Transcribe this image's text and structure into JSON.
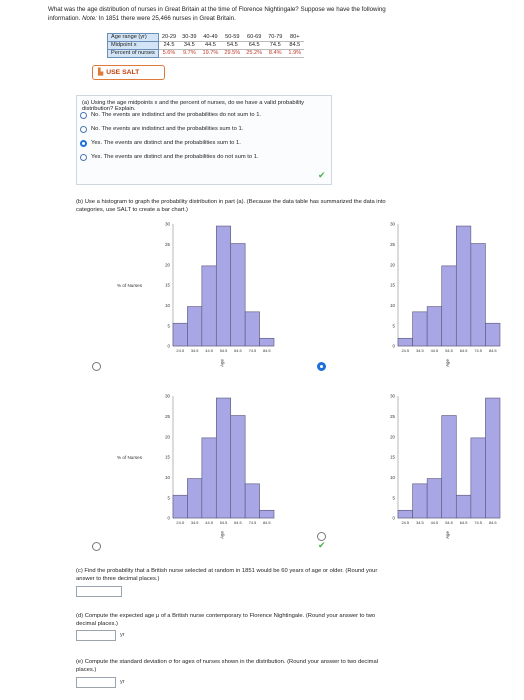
{
  "intro": {
    "line1": "What was the age distribution of nurses in Great Britain at the time of Florence Nightingale? Suppose we have the following",
    "line2_a": "information.",
    "line2_note": "Note:",
    "line2_b": "In 1851 there were 25,466 nurses in Great Britain."
  },
  "table": {
    "headers": [
      "Age range (yr)",
      "Midpoint x",
      "Percent of nurses"
    ],
    "ranges": [
      "20-29",
      "30-39",
      "40-49",
      "50-59",
      "60-69",
      "70-79",
      "80+"
    ],
    "midpoints": [
      "24.5",
      "34.5",
      "44.5",
      "54.5",
      "64.5",
      "74.5",
      "84.5"
    ],
    "percents": [
      "5.6%",
      "9.7%",
      "19.7%",
      "29.5%",
      "25.2%",
      "8.4%",
      "1.9%"
    ]
  },
  "salt": {
    "label": "USE SALT",
    "icon": "chart-icon"
  },
  "part_a": {
    "question": "(a) Using the age midpoints x and the percent of nurses, do we have a valid probability distribution? Explain.",
    "options": [
      "No. The events are indistinct and the probabilities do not sum to 1.",
      "No. The events are indistinct and the probabilities sum to 1.",
      "Yes. The events are distinct and the probabilities sum to 1.",
      "Yes. The events are distinct and the probabilities do not sum to 1."
    ],
    "selected_index": 2,
    "check": "✔"
  },
  "part_b": {
    "line1": "(b) Use a histogram to graph the probability distribution in part (a). (Because the data table has summarized the data into",
    "line2": "categories, use SALT to create a bar chart.)",
    "selected_index": 1,
    "check": "✔"
  },
  "chart_data": [
    {
      "type": "bar",
      "categories": [
        "24.5",
        "34.5",
        "44.5",
        "54.5",
        "64.5",
        "74.5",
        "84.5"
      ],
      "values": [
        5.6,
        9.7,
        19.7,
        29.5,
        25.2,
        8.4,
        1.9
      ],
      "ylabel": "% of Nurses",
      "xlabel": "Age",
      "yticks": [
        "0",
        "5",
        "10",
        "15",
        "20",
        "25",
        "30"
      ],
      "ylim": [
        0,
        30
      ]
    },
    {
      "type": "bar",
      "categories": [
        "24.5",
        "34.5",
        "44.5",
        "54.5",
        "64.5",
        "74.5",
        "84.5"
      ],
      "values": [
        1.9,
        8.4,
        9.7,
        19.7,
        29.5,
        25.2,
        5.6
      ],
      "ylabel": "% of Nurses",
      "xlabel": "Age",
      "yticks": [
        "0",
        "5",
        "10",
        "15",
        "20",
        "25",
        "30"
      ],
      "ylim": [
        0,
        30
      ]
    },
    {
      "type": "bar",
      "categories": [
        "24.5",
        "34.5",
        "44.5",
        "54.5",
        "64.5",
        "74.5",
        "84.5"
      ],
      "values": [
        5.6,
        9.7,
        19.7,
        29.5,
        25.2,
        8.4,
        1.9
      ],
      "ylabel": "% of Nurses",
      "xlabel": "Age",
      "yticks": [
        "0",
        "5",
        "10",
        "15",
        "20",
        "25",
        "30"
      ],
      "ylim": [
        0,
        30
      ]
    },
    {
      "type": "bar",
      "categories": [
        "24.5",
        "34.5",
        "44.5",
        "54.5",
        "64.5",
        "74.5",
        "84.5"
      ],
      "values": [
        1.9,
        8.4,
        9.7,
        25.2,
        5.6,
        19.7,
        29.5
      ],
      "ylabel": "% of Nurses",
      "xlabel": "Age",
      "yticks": [
        "0",
        "5",
        "10",
        "15",
        "20",
        "25",
        "30"
      ],
      "ylim": [
        0,
        30
      ]
    }
  ],
  "part_c": {
    "line1": "(c) Find the probability that a British nurse selected at random in 1851 would be 60 years of age or older. (Round your",
    "line2": "answer to three decimal places.)",
    "value": ""
  },
  "part_d": {
    "line1": "(d) Compute the expected age μ of a British nurse contemporary to Florence Nightingale. (Round your answer to two",
    "line2": "decimal places.)",
    "unit": "yr",
    "value": ""
  },
  "part_e": {
    "line1": "(e) Compute the standard deviation σ for ages of nurses shown in the distribution. (Round your answer to two decimal",
    "line2": "places.)",
    "unit": "yr",
    "value": ""
  },
  "colors": {
    "bar_fill": "#a9a6e6",
    "bar_stroke": "#555577",
    "accent": "#1e6fd9",
    "correct": "#4caf50",
    "salt": "#e07a3a"
  }
}
